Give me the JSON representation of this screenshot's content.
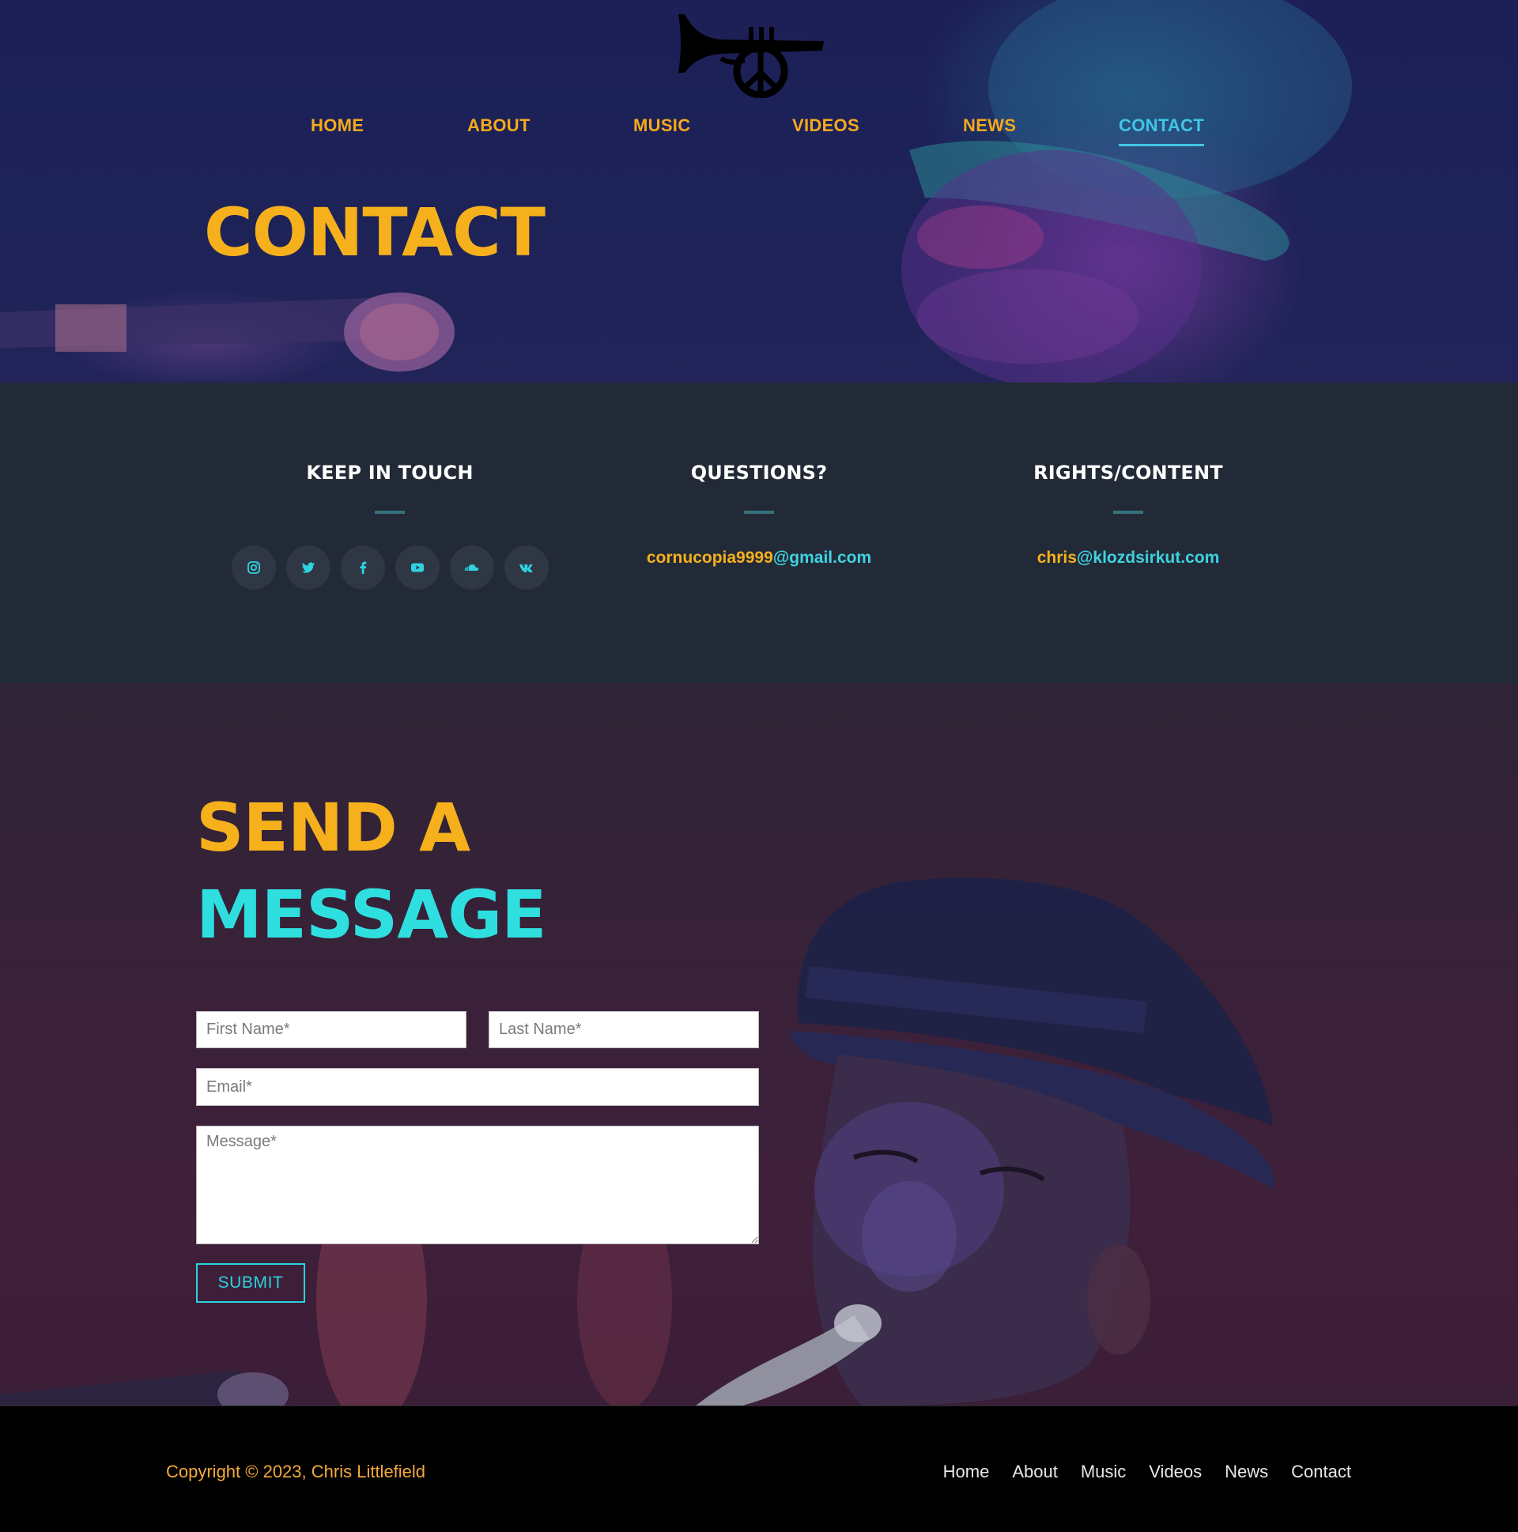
{
  "colors": {
    "accent_orange": "#f6b01c",
    "accent_cyan": "#2fdfe0",
    "nav_active": "#41c6e4",
    "info_bg": "#232a37",
    "footer_bg": "#000000"
  },
  "header": {
    "logo_icon": "trumpet-peace-logo",
    "nav": [
      {
        "label": "HOME",
        "active": false
      },
      {
        "label": "ABOUT",
        "active": false
      },
      {
        "label": "MUSIC",
        "active": false
      },
      {
        "label": "VIDEOS",
        "active": false
      },
      {
        "label": "NEWS",
        "active": false
      },
      {
        "label": "CONTACT",
        "active": true
      }
    ],
    "title": "CONTACT"
  },
  "info": {
    "keep_in_touch": {
      "heading": "KEEP IN TOUCH",
      "socials": [
        "instagram-icon",
        "twitter-icon",
        "facebook-icon",
        "youtube-icon",
        "soundcloud-icon",
        "vk-icon"
      ]
    },
    "questions": {
      "heading": "QUESTIONS?",
      "email_user": "cornucopia9999",
      "email_domain": "@gmail.com"
    },
    "rights": {
      "heading": "RIGHTS/CONTENT",
      "email_user": "chris",
      "email_domain": "@klozdsirkut.com"
    }
  },
  "message": {
    "title_line1": "SEND A",
    "title_line2": "MESSAGE",
    "first_name_placeholder": "First Name*",
    "last_name_placeholder": "Last Name*",
    "email_placeholder": "Email*",
    "message_placeholder": "Message*",
    "submit_label": "SUBMIT"
  },
  "footer": {
    "copyright": "Copyright © 2023, Chris Littlefield",
    "links": [
      "Home",
      "About",
      "Music",
      "Videos",
      "News",
      "Contact"
    ]
  }
}
